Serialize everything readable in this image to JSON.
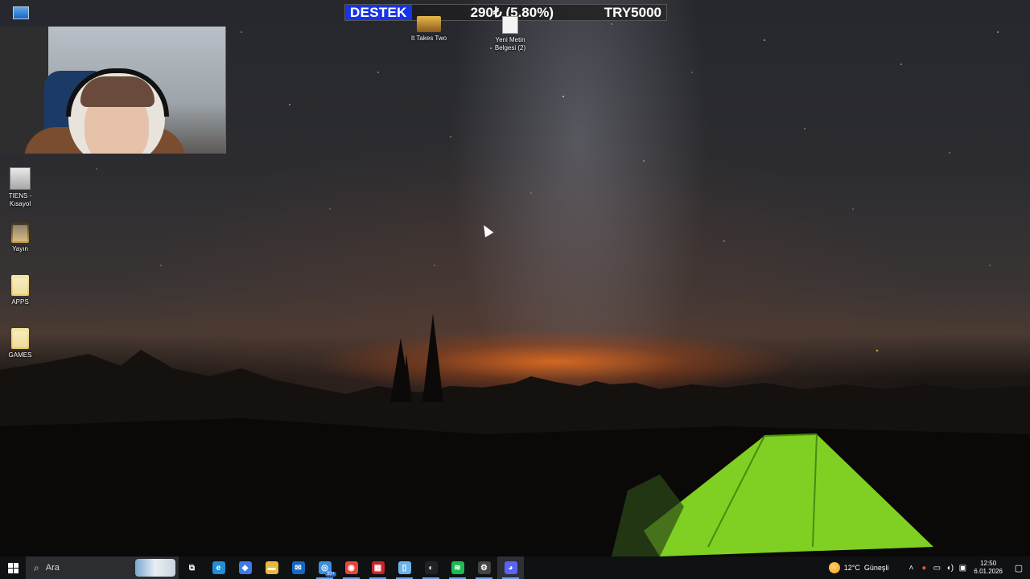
{
  "overlay": {
    "donation_label": "DESTEK",
    "donation_amount": "290₺ (5.80%)",
    "donation_goal": "TRY5000",
    "donation_color": "#1734e8"
  },
  "desktop_icons": {
    "it_takes_two": "It Takes Two",
    "yeni_metin_1": "Yeni Metin",
    "yeni_metin_2": "Belgesi (2)",
    "tiens_1": "TIENS -",
    "tiens_2": "Kısayol",
    "yayin": "Yayın",
    "apps": "APPS",
    "games": "GAMES"
  },
  "taskbar": {
    "search_placeholder": "Ara",
    "apps": [
      {
        "name": "task-view",
        "glyph": "⧉"
      },
      {
        "name": "edge",
        "glyph": "e",
        "color": "#1f8fd6"
      },
      {
        "name": "copilot",
        "glyph": "◆",
        "color": "#3c7bea"
      },
      {
        "name": "file-explorer",
        "glyph": "▬",
        "color": "#e8b93d"
      },
      {
        "name": "outlook",
        "glyph": "✉",
        "color": "#1468c4"
      },
      {
        "name": "whatsapp",
        "glyph": "◎",
        "color": "#3d8edb",
        "badge": "99+"
      },
      {
        "name": "chrome",
        "glyph": "◉",
        "color": "#e8453c"
      },
      {
        "name": "game-launcher",
        "glyph": "▦",
        "color": "#c9252c"
      },
      {
        "name": "notepad",
        "glyph": "▯",
        "color": "#6fb3e8"
      },
      {
        "name": "obs",
        "glyph": "◐",
        "color": "#222"
      },
      {
        "name": "spotify",
        "glyph": "≋",
        "color": "#1db954"
      },
      {
        "name": "settings",
        "glyph": "⚙",
        "color": "#444"
      },
      {
        "name": "discord",
        "glyph": "◕",
        "color": "#5865f2"
      }
    ],
    "weather_temp": "12°C",
    "weather_desc": "Güneşli",
    "time": "12:50",
    "date": "6.01.2026"
  }
}
